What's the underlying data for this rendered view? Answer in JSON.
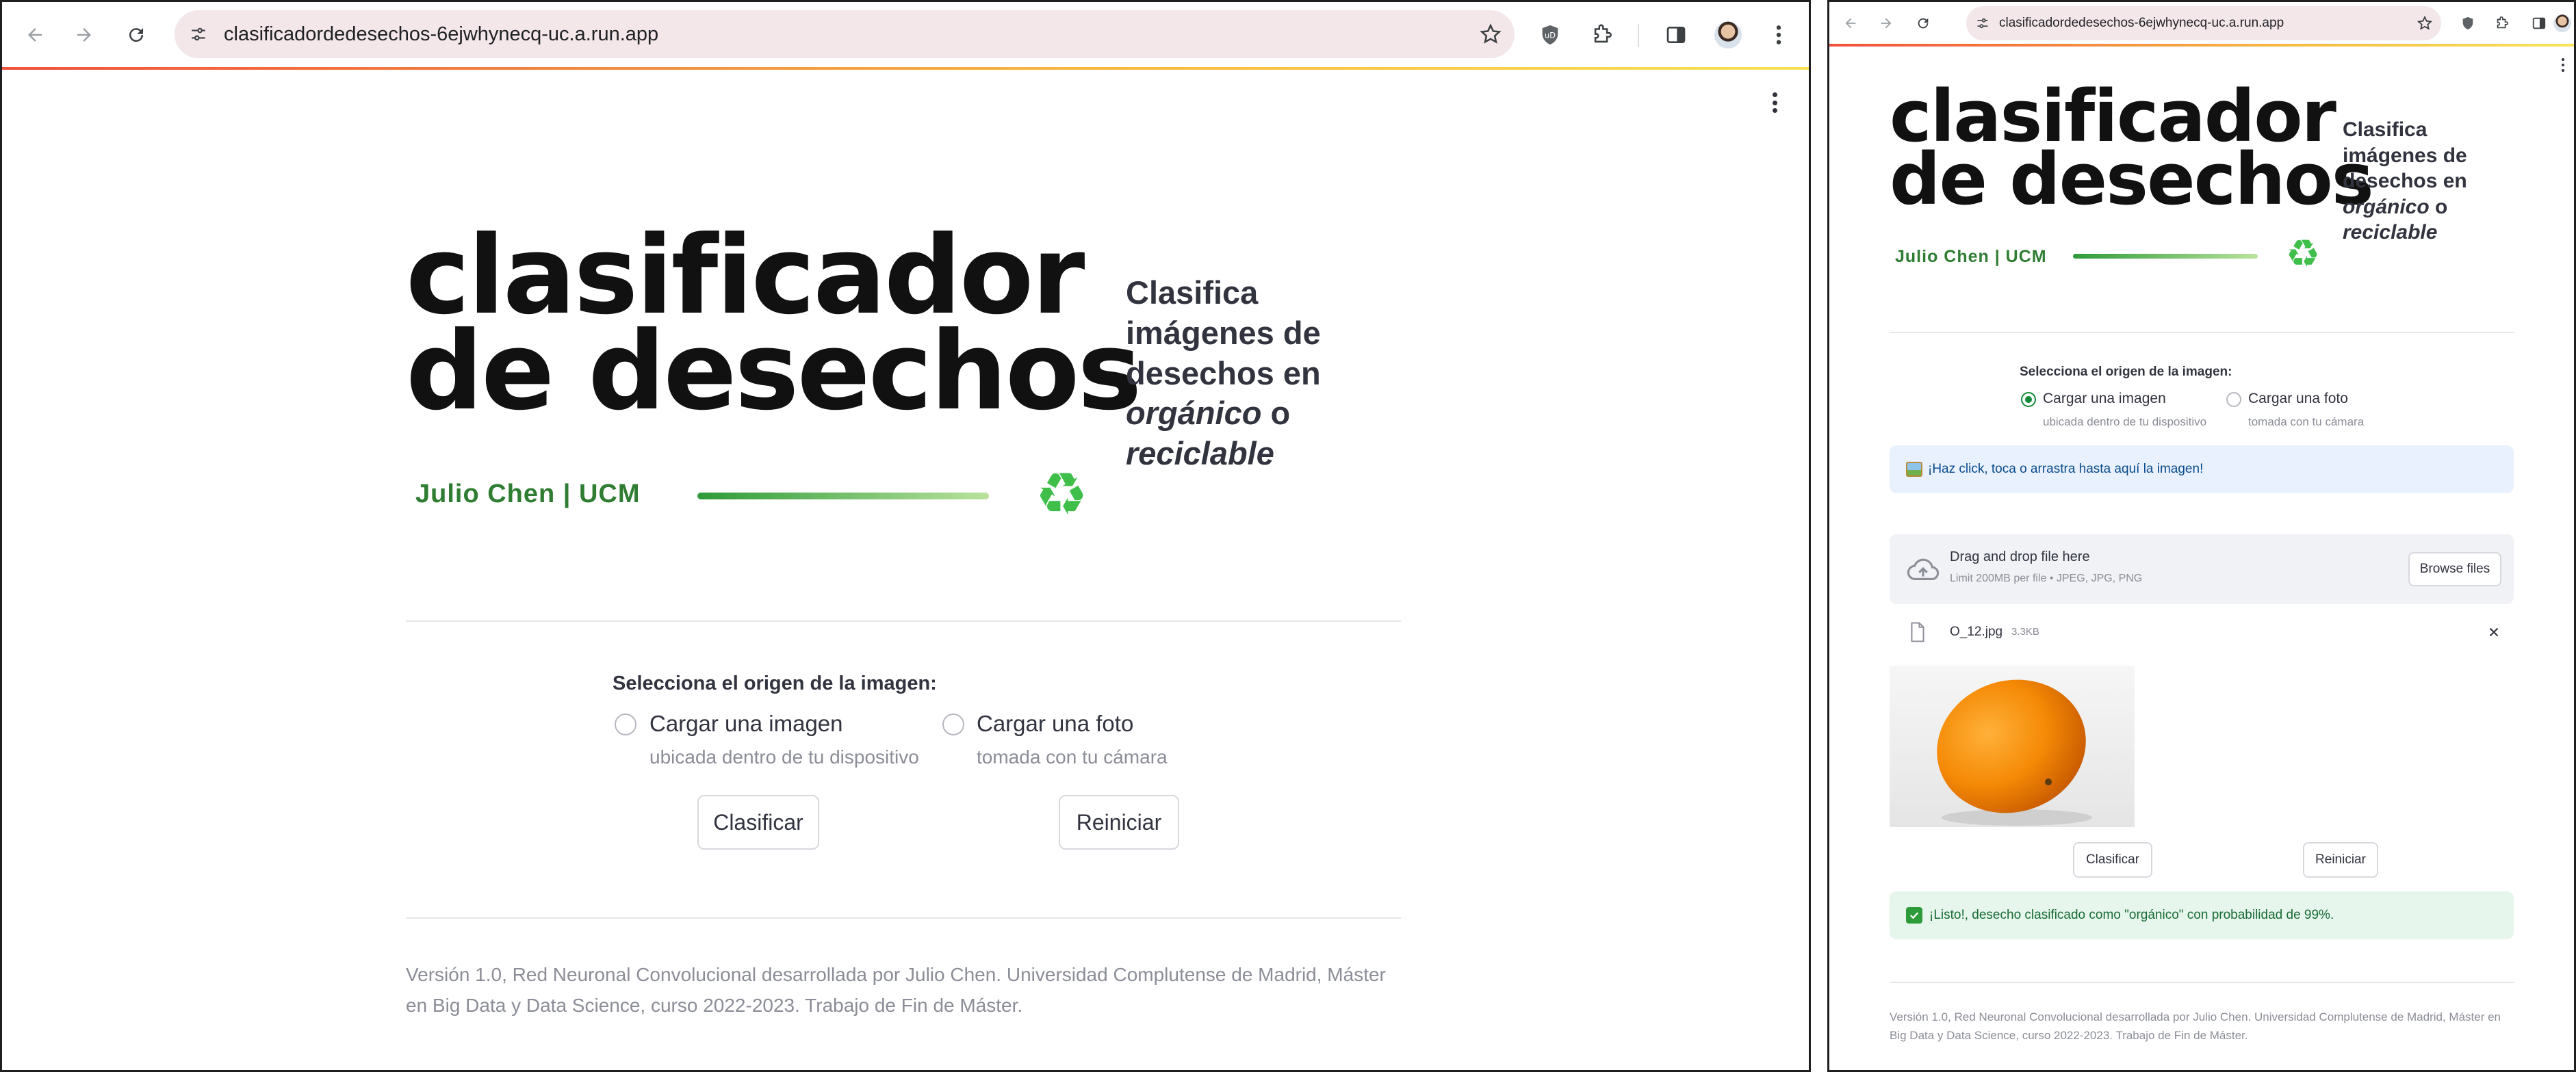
{
  "browser": {
    "url": "clasificadordedesechos-6ejwhynecq-uc.a.run.app",
    "icons": [
      "back-arrow-icon",
      "forward-arrow-icon",
      "reload-icon",
      "site-settings-icon",
      "star-icon",
      "shield-extension-icon",
      "puzzle-extensions-icon",
      "side-panel-icon",
      "profile-avatar",
      "more-menu-icon"
    ]
  },
  "logo": {
    "title_line1": "clasificador",
    "title_line2": "de desechos",
    "author": "Julio Chen | UCM",
    "recycle_symbol": "♻"
  },
  "tagline": {
    "l1": "Clasifica",
    "l2": "imágenes de",
    "l3": "desechos en",
    "organic": "orgánico",
    "o": "o",
    "recyclable": "reciclable"
  },
  "source": {
    "label": "Selecciona el origen de la imagen:",
    "options": [
      {
        "label": "Cargar una imagen",
        "caption": "ubicada dentro de tu dispositivo"
      },
      {
        "label": "Cargar una foto",
        "caption": "tomada con tu cámara"
      }
    ]
  },
  "buttons": {
    "classify": "Clasificar",
    "reset": "Reiniciar"
  },
  "uploader": {
    "info": "¡Haz click, toca o arrastra hasta aquí la imagen!",
    "drop_title": "Drag and drop file here",
    "drop_limit": "Limit 200MB per file • JPEG, JPG, PNG",
    "browse": "Browse files",
    "file_name": "O_12.jpg",
    "file_size": "3.3KB"
  },
  "result": {
    "message": "¡Listo!, desecho clasificado como \"orgánico\" con probabilidad de 99%."
  },
  "footer": {
    "text": "Versión 1.0, Red Neuronal Convolucional desarrollada por Julio Chen. Universidad Complutense de Madrid, Máster en Big Data y Data Science, curso 2022-2023. Trabajo de Fin de Máster."
  },
  "colors": {
    "accent_green": "#0f8a37",
    "info_bg": "#e8f1fd",
    "success_bg": "#e6f6ec",
    "loading_bar": "#f0523c"
  }
}
